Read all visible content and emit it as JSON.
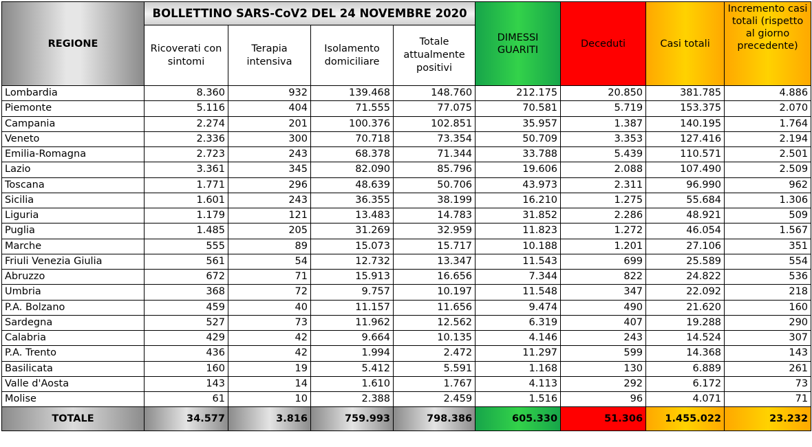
{
  "title": "BOLLETTINO SARS-CoV2 DEL 24 NOVEMBRE 2020",
  "headers": {
    "region": "REGIONE",
    "ricoverati": "Ricoverati con sintomi",
    "terapia": "Terapia intensiva",
    "isolamento": "Isolamento domiciliare",
    "totale_positivi": "Totale attualmente positivi",
    "dimessi": "DIMESSI GUARITI",
    "deceduti": "Deceduti",
    "casi_totali": "Casi totali",
    "incremento": "Incremento casi totali (rispetto al giorno precedente)"
  },
  "header_colors": {
    "dimessi": "#22b34a",
    "deceduti": "#ff0000",
    "casi_totali": "#ffc000",
    "incremento": "#ffc000"
  },
  "rows": [
    [
      "Lombardia",
      "8.360",
      "932",
      "139.468",
      "148.760",
      "212.175",
      "20.850",
      "381.785",
      "4.886"
    ],
    [
      "Piemonte",
      "5.116",
      "404",
      "71.555",
      "77.075",
      "70.581",
      "5.719",
      "153.375",
      "2.070"
    ],
    [
      "Campania",
      "2.274",
      "201",
      "100.376",
      "102.851",
      "35.957",
      "1.387",
      "140.195",
      "1.764"
    ],
    [
      "Veneto",
      "2.336",
      "300",
      "70.718",
      "73.354",
      "50.709",
      "3.353",
      "127.416",
      "2.194"
    ],
    [
      "Emilia-Romagna",
      "2.723",
      "243",
      "68.378",
      "71.344",
      "33.788",
      "5.439",
      "110.571",
      "2.501"
    ],
    [
      "Lazio",
      "3.361",
      "345",
      "82.090",
      "85.796",
      "19.606",
      "2.088",
      "107.490",
      "2.509"
    ],
    [
      "Toscana",
      "1.771",
      "296",
      "48.639",
      "50.706",
      "43.973",
      "2.311",
      "96.990",
      "962"
    ],
    [
      "Sicilia",
      "1.601",
      "243",
      "36.355",
      "38.199",
      "16.210",
      "1.275",
      "55.684",
      "1.306"
    ],
    [
      "Liguria",
      "1.179",
      "121",
      "13.483",
      "14.783",
      "31.852",
      "2.286",
      "48.921",
      "509"
    ],
    [
      "Puglia",
      "1.485",
      "205",
      "31.269",
      "32.959",
      "11.823",
      "1.272",
      "46.054",
      "1.567"
    ],
    [
      "Marche",
      "555",
      "89",
      "15.073",
      "15.717",
      "10.188",
      "1.201",
      "27.106",
      "351"
    ],
    [
      "Friuli Venezia Giulia",
      "561",
      "54",
      "12.732",
      "13.347",
      "11.543",
      "699",
      "25.589",
      "554"
    ],
    [
      "Abruzzo",
      "672",
      "71",
      "15.913",
      "16.656",
      "7.344",
      "822",
      "24.822",
      "536"
    ],
    [
      "Umbria",
      "368",
      "72",
      "9.757",
      "10.197",
      "11.548",
      "347",
      "22.092",
      "218"
    ],
    [
      "P.A. Bolzano",
      "459",
      "40",
      "11.157",
      "11.656",
      "9.474",
      "490",
      "21.620",
      "160"
    ],
    [
      "Sardegna",
      "527",
      "73",
      "11.962",
      "12.562",
      "6.319",
      "407",
      "19.288",
      "290"
    ],
    [
      "Calabria",
      "429",
      "42",
      "9.664",
      "10.135",
      "4.146",
      "243",
      "14.524",
      "307"
    ],
    [
      "P.A. Trento",
      "436",
      "42",
      "1.994",
      "2.472",
      "11.297",
      "599",
      "14.368",
      "143"
    ],
    [
      "Basilicata",
      "160",
      "19",
      "5.412",
      "5.591",
      "1.168",
      "130",
      "6.889",
      "261"
    ],
    [
      "Valle d'Aosta",
      "143",
      "14",
      "1.610",
      "1.767",
      "4.113",
      "292",
      "6.172",
      "73"
    ],
    [
      "Molise",
      "61",
      "10",
      "2.388",
      "2.459",
      "1.516",
      "96",
      "4.071",
      "71"
    ]
  ],
  "totals": {
    "label": "TOTALE",
    "values": [
      "34.577",
      "3.816",
      "759.993",
      "798.386",
      "605.330",
      "51.306",
      "1.455.022",
      "23.232"
    ]
  }
}
